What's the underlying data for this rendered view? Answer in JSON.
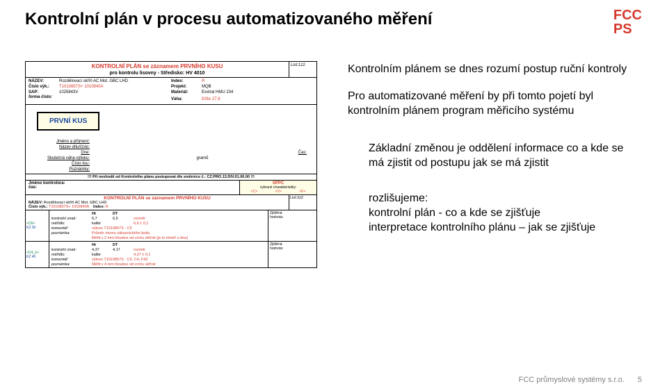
{
  "slide": {
    "title": "Kontrolní plán v procesu automatizovaného měření",
    "logo_line1": "FCC",
    "logo_line2": "PS"
  },
  "form": {
    "header": {
      "title_red": "KONTROLNÍ PLÁN se záznamem PRVNÍHO KUSU",
      "subtitle": "pro kontrolu lisovny - Středisko: HV 4010",
      "list_label": "List:1z2"
    },
    "meta": {
      "nazev_lbl": "NÁZEV:",
      "nazev_val": "Rozdělovací skříň AC Mot. GBC LHD",
      "cislo_lbl": "Číslo výk.:",
      "cislo_val": "T1010857S+ 1010840A",
      "sap_lbl": "SAP:",
      "sap_val": "1025843V",
      "forma_lbl": "forma číslo:",
      "index_lbl": "Index:",
      "index_val": "R",
      "projekt_lbl": "Projekt:",
      "projekt_val": "MQB",
      "material_lbl": "Materiál:",
      "material_val": "Exxtral HMU 234",
      "vaha_lbl": "Váha:",
      "vaha_val": "926± 27,8"
    },
    "prvni_kus": "PRVNÍ KUS",
    "fields": {
      "jmeno_lbl": "Jméno a příjmení:",
      "nazev_dilu_lbl": "Název dílu/číslo:",
      "dne_lbl": "Dne:",
      "cas_lbl": "Čas:",
      "skut_vaha_lbl": "Skutečná váha výlisku:",
      "gramu": "gramů",
      "cislo_lisu_lbl": "Číslo lisu:",
      "poznamky_lbl": "Poznámky:"
    },
    "warning": "!!! Při neshodě od Kontrolního plánu postupovat dle směrnice č.: CZ.PRO.13.DIV.01.00.00 !!!",
    "kontrolor": {
      "jmeno_lbl": "Jméno kontrolora:",
      "cas_lbl": "čas:",
      "sppc": "SPPC",
      "vybrane": "vybrané charakteristiky:",
      "c": "<C>",
      "v": "<V>",
      "f": "<F>"
    },
    "header2": {
      "title_red": "KONTROLNÍ PLÁN se záznamem PRVNÍHO KUSU",
      "nazev_lbl": "NÁZEV:",
      "nazev_val": "Rozdělovací skříň AC Mot. GBC LHD",
      "cislo_lbl": "Číslo výk.:",
      "cislo_val": "T1010857S+ 1010840A",
      "index_lbl": "Index:",
      "index_val": "R",
      "list_label": "List:2z2"
    },
    "meas1": {
      "tag1": "<C6>",
      "tag2": "KZ 30",
      "kz_lbl": "kontrolní znak:",
      "ht_lbl": "Ht",
      "dt_lbl": "DT",
      "ht_val": "6,7",
      "dt_val": "6,5",
      "rozmer": "rozměr",
      "meridlo_lbl": "měřidlo:",
      "meridlo_val": "kalibr",
      "tol": "6,6 ± 0,1",
      "komentar_lbl": "komentář:",
      "komentar_val": "výkres T1010857S - C5",
      "poznamka_lbl": "poznámka:",
      "poznamka_val1": "Průměr otvoru zákaznického bodu",
      "poznamka_val2": "Měřit v 2 mm hloubce od vrchu skříně (je to téměř u dna)",
      "zjistena_lbl": "Zjištěná",
      "hodnota_lbl": "hodnota:"
    },
    "meas2": {
      "tag1": "<C4_1>",
      "tag2": "KZ 40",
      "kz_lbl": "kontrolní znak:",
      "ht_lbl": "Ht",
      "dt_lbl": "DT",
      "ht_val": "4,37",
      "dt_val": "4,17",
      "rozmer": "rozměr",
      "meridlo_lbl": "měřidlo:",
      "meridlo_val": "kalibr",
      "tol": "4,27 ± 0,1",
      "komentar_lbl": "komentář:",
      "komentar_val": "výkres T1010857S - C5, C4, F43",
      "poznamka_lbl": "poznámka:",
      "poznamka_val": "Měřit v 4 mm hloubce od vrchu skříně",
      "zjistena_lbl": "Zjištěná",
      "hodnota_lbl": "hodnota:"
    }
  },
  "right_text": {
    "p1": "Kontrolním plánem se dnes rozumí postup ruční kontroly",
    "p2": "Pro automatizované měření by při tomto pojetí byl kontrolním plánem program měřicího systému",
    "p3": "Základní změnou je oddělení informace co a kde se má zjistit od postupu jak se má zjistit",
    "p4a": "rozlišujeme:",
    "p4b": "kontrolní plán - co a kde se zjišťuje",
    "p4c": "interpretace kontrolního plánu – jak se zjišťuje"
  },
  "footer": {
    "company": "FCC průmyslové systémy s.r.o.",
    "page": "5"
  }
}
